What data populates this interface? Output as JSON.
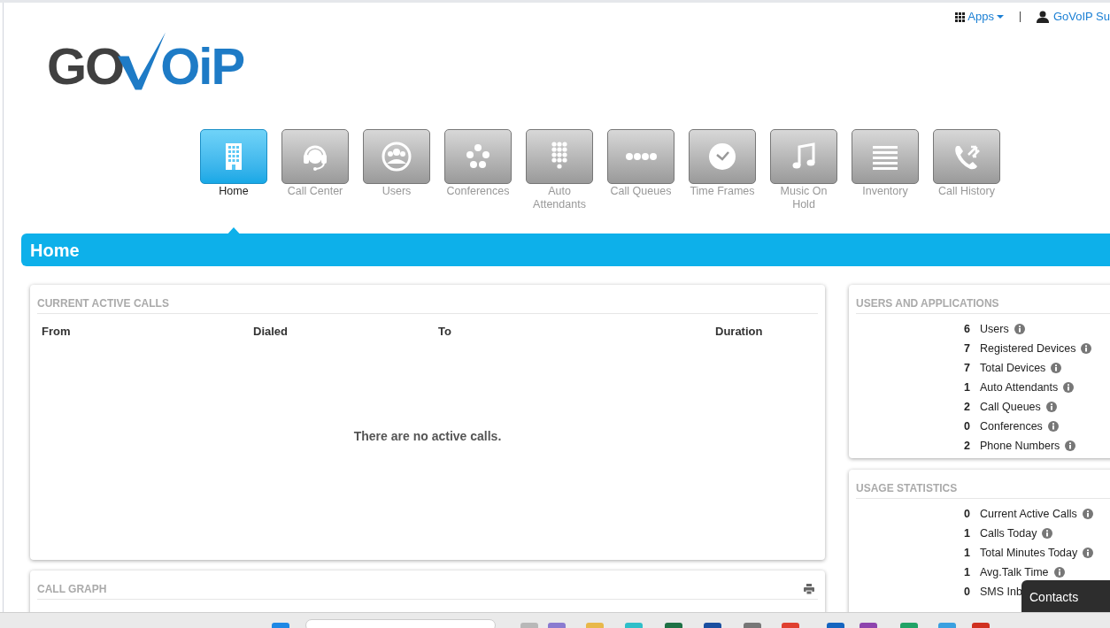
{
  "header": {
    "apps_menu": "Apps",
    "user_menu": "GoVoIP Su"
  },
  "logo": {
    "left": "GO",
    "right": "OiP"
  },
  "nav": [
    {
      "label": "Home",
      "selected": true
    },
    {
      "label": "Call Center",
      "selected": false
    },
    {
      "label": "Users",
      "selected": false
    },
    {
      "label": "Conferences",
      "selected": false
    },
    {
      "label": "Auto Attendants",
      "selected": false
    },
    {
      "label": "Call Queues",
      "selected": false
    },
    {
      "label": "Time Frames",
      "selected": false
    },
    {
      "label": "Music On Hold",
      "selected": false
    },
    {
      "label": "Inventory",
      "selected": false
    },
    {
      "label": "Call History",
      "selected": false
    }
  ],
  "page_title": "Home",
  "active_calls": {
    "title": "CURRENT ACTIVE CALLS",
    "columns": [
      "From",
      "Dialed",
      "To",
      "Duration"
    ],
    "empty_message": "There are no active calls."
  },
  "call_graph": {
    "title": "CALL GRAPH"
  },
  "users_and_applications": {
    "title": "USERS AND APPLICATIONS",
    "rows": [
      {
        "count": "6",
        "label": "Users"
      },
      {
        "count": "7",
        "label": "Registered Devices"
      },
      {
        "count": "7",
        "label": "Total Devices"
      },
      {
        "count": "1",
        "label": "Auto Attendants"
      },
      {
        "count": "2",
        "label": "Call Queues"
      },
      {
        "count": "0",
        "label": "Conferences"
      },
      {
        "count": "2",
        "label": "Phone Numbers"
      }
    ]
  },
  "usage_statistics": {
    "title": "USAGE STATISTICS",
    "rows": [
      {
        "count": "0",
        "label": "Current Active Calls"
      },
      {
        "count": "1",
        "label": "Calls Today"
      },
      {
        "count": "1",
        "label": "Total Minutes Today"
      },
      {
        "count": "1",
        "label": "Avg.Talk Time"
      },
      {
        "count": "0",
        "label": "SMS Inb"
      }
    ]
  },
  "contacts_popup": {
    "label": "Contacts"
  }
}
